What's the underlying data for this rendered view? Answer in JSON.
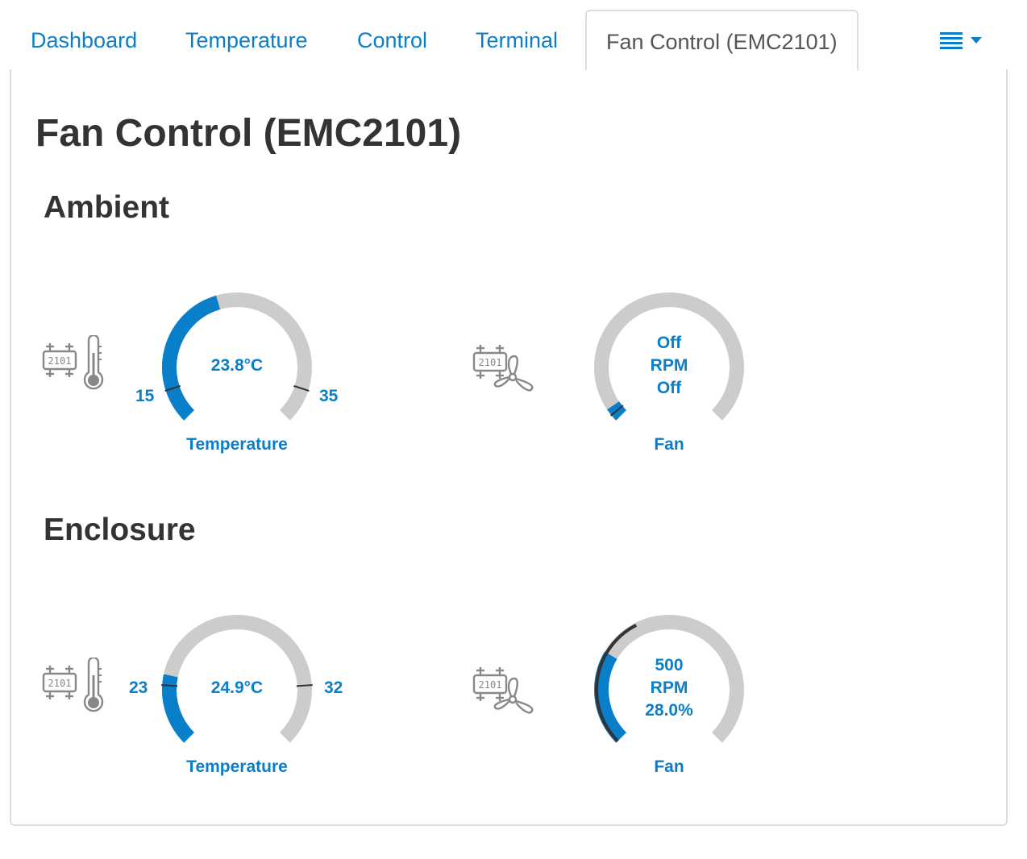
{
  "tabs": [
    {
      "label": "Dashboard"
    },
    {
      "label": "Temperature"
    },
    {
      "label": "Control"
    },
    {
      "label": "Terminal"
    },
    {
      "label": "Fan Control (EMC2101)",
      "active": true
    }
  ],
  "menu_icon": "list-menu-icon",
  "page_title": "Fan Control (EMC2101)",
  "colors": {
    "accent": "#0a7fc9",
    "track": "#cccccc",
    "icon": "#888888",
    "needle": "#333333"
  },
  "ambient": {
    "title": "Ambient",
    "temperature": {
      "value": 23.8,
      "display": "23.8°C",
      "min": 15,
      "max": 35,
      "min_label": "15",
      "max_label": "35",
      "label": "Temperature",
      "icons": [
        "chip-2101-icon",
        "thermometer-icon"
      ],
      "chip_text": "2101"
    },
    "fan": {
      "rpm": "Off",
      "unit": "RPM",
      "percent": "Off",
      "level": 0.04,
      "label": "Fan",
      "icons": [
        "chip-2101-icon",
        "fan-icon"
      ],
      "chip_text": "2101"
    }
  },
  "enclosure": {
    "title": "Enclosure",
    "temperature": {
      "value": 24.9,
      "display": "24.9°C",
      "min": 23,
      "max": 32,
      "min_label": "23",
      "max_label": "32",
      "label": "Temperature",
      "icons": [
        "chip-2101-icon",
        "thermometer-icon"
      ],
      "chip_text": "2101"
    },
    "fan": {
      "rpm": "500",
      "unit": "RPM",
      "percent": "28.0%",
      "level": 0.28,
      "needle_level": 0.12,
      "label": "Fan",
      "icons": [
        "chip-2101-icon",
        "fan-icon"
      ],
      "chip_text": "2101"
    }
  }
}
